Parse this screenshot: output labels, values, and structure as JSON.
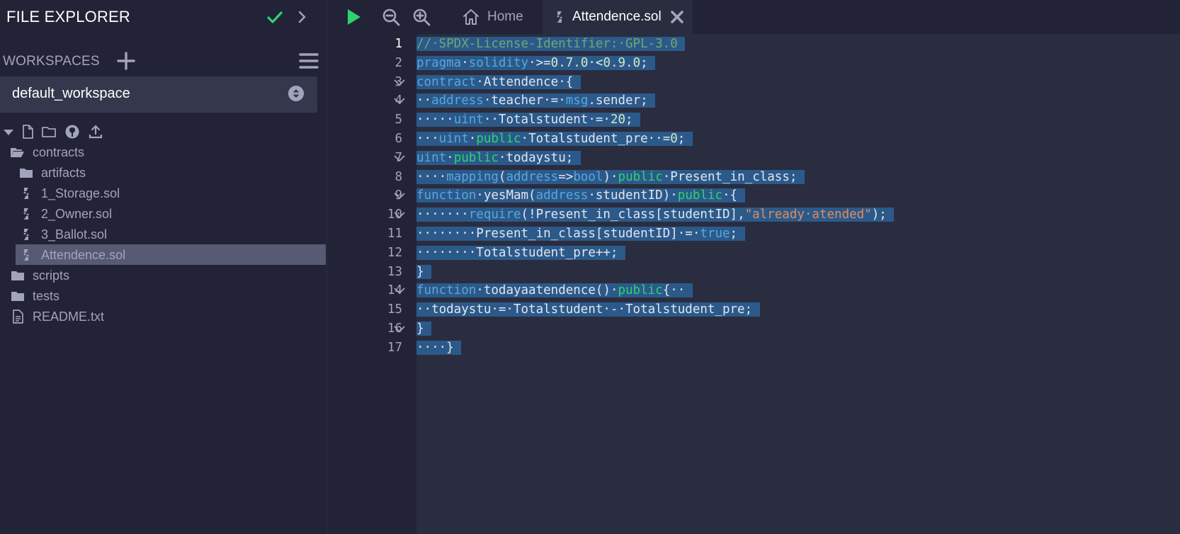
{
  "sidebar": {
    "title": "FILE EXPLORER",
    "workspaces_label": "WORKSPACES",
    "workspace_selected": "default_workspace",
    "tree": [
      {
        "label": "contracts",
        "type": "folder-open",
        "indent": 0
      },
      {
        "label": "artifacts",
        "type": "folder",
        "indent": 1
      },
      {
        "label": "1_Storage.sol",
        "type": "sol",
        "indent": 1
      },
      {
        "label": "2_Owner.sol",
        "type": "sol",
        "indent": 1
      },
      {
        "label": "3_Ballot.sol",
        "type": "sol",
        "indent": 1
      },
      {
        "label": "Attendence.sol",
        "type": "sol",
        "indent": 1,
        "selected": true
      },
      {
        "label": "scripts",
        "type": "folder",
        "indent": 0
      },
      {
        "label": "tests",
        "type": "folder",
        "indent": 0
      },
      {
        "label": "README.txt",
        "type": "file",
        "indent": 0
      }
    ]
  },
  "tabs": {
    "home_label": "Home",
    "active_label": "Attendence.sol"
  },
  "editor": {
    "active_line": 1,
    "lines": [
      {
        "n": "1",
        "fold": false,
        "html": "<span class=\"t-cmt\">//·SPDX-License-Identifier:·GPL-3.0</span>"
      },
      {
        "n": "2",
        "fold": false,
        "html": "<span class=\"t-kw\">pragma</span>·<span class=\"t-kw\">solidity</span>·>=<span class=\"t-num\">0.7.0</span>·<<span class=\"t-num\">0.9.0</span>;"
      },
      {
        "n": "3",
        "fold": true,
        "html": "<span class=\"t-kw\">contract</span>·Attendence·{"
      },
      {
        "n": "4",
        "fold": true,
        "html": "··<span class=\"t-typ\">address</span>·teacher·=·<span class=\"t-kw\">msg</span>.sender;"
      },
      {
        "n": "5",
        "fold": false,
        "html": "·····<span class=\"t-typ\">uint</span>··Totalstudent·=·<span class=\"t-num\">20</span>;"
      },
      {
        "n": "6",
        "fold": false,
        "html": "···<span class=\"t-typ\">uint</span>·<span class=\"t-pub\">public</span>·Totalstudent_pre··=<span class=\"t-num\">0</span>;"
      },
      {
        "n": "7",
        "fold": true,
        "html": "<span class=\"t-typ\">uint</span>·<span class=\"t-pub\">public</span>·todaystu;"
      },
      {
        "n": "8",
        "fold": false,
        "html": "····<span class=\"t-kw\">mapping</span>(<span class=\"t-typ\">address</span>=><span class=\"t-typ\">bool</span>)·<span class=\"t-pub\">public</span>·Present_in_class;"
      },
      {
        "n": "9",
        "fold": true,
        "html": "<span class=\"t-kw\">function</span>·yesMam(<span class=\"t-typ\">address</span>·studentID)·<span class=\"t-pub\">public</span>·{"
      },
      {
        "n": "10",
        "fold": true,
        "html": "·······<span class=\"t-kw\">require</span>(!Present_in_class[studentID],<span class=\"t-str\">\"already·atended\"</span>);"
      },
      {
        "n": "11",
        "fold": false,
        "html": "········Present_in_class[studentID]·=·<span class=\"t-bool\">true</span>;"
      },
      {
        "n": "12",
        "fold": false,
        "html": "········Totalstudent_pre++;"
      },
      {
        "n": "13",
        "fold": false,
        "html": "}"
      },
      {
        "n": "14",
        "fold": true,
        "html": "<span class=\"t-kw\">function</span>·todayaatendence()·<span class=\"t-pub\">public</span>{··"
      },
      {
        "n": "15",
        "fold": false,
        "html": "··todaystu·=·Totalstudent·-·Totalstudent_pre;"
      },
      {
        "n": "16",
        "fold": true,
        "html": "}"
      },
      {
        "n": "17",
        "fold": false,
        "html": "····}"
      }
    ]
  },
  "colors": {
    "accent_green": "#2fd26f",
    "selection": "#2b5a8a",
    "sidebar_bg": "#222336",
    "editor_bg": "#2a2c3f"
  }
}
